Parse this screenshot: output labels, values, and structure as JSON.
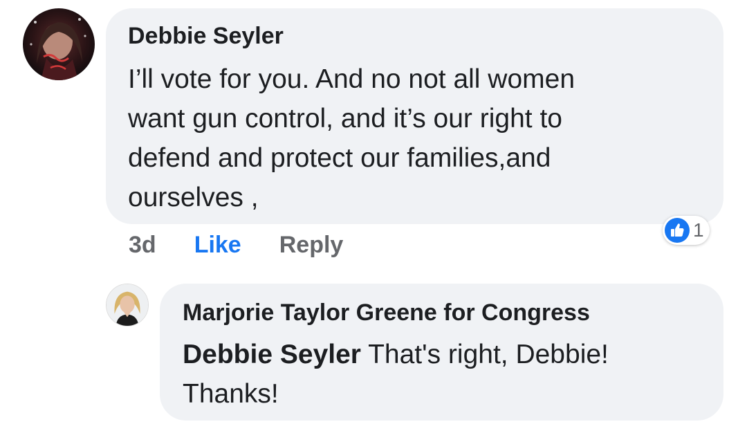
{
  "comment": {
    "author": "Debbie Seyler",
    "text_lines": [
      "I’ll vote for you. And no not all women",
      "want gun control, and it’s our right to",
      "defend and protect our families,and",
      "ourselves ,"
    ],
    "time": "3d",
    "like_label": "Like",
    "reply_label": "Reply",
    "reaction_count": "1",
    "reaction_icon": "like-thumb-icon",
    "accent_color": "#1877f2"
  },
  "reply": {
    "author": "Marjorie Taylor Greene for Congress",
    "mention": "Debbie Seyler",
    "text_line1": " That's right, Debbie!",
    "text_line2": "Thanks!"
  }
}
